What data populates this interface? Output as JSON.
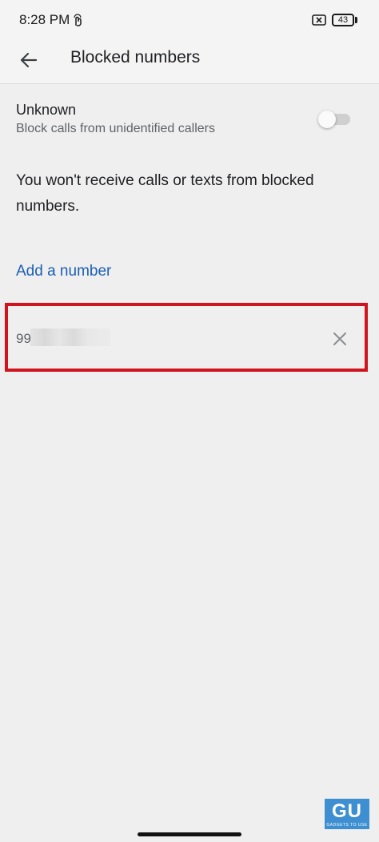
{
  "status_bar": {
    "time": "8:28 PM",
    "battery_level": "43",
    "icons": [
      "gesture-icon",
      "no-sim-icon",
      "battery-icon"
    ]
  },
  "app_bar": {
    "title": "Blocked numbers",
    "back_icon": "arrow-back-icon"
  },
  "unknown_setting": {
    "title": "Unknown",
    "subtitle": "Block calls from unidentified callers",
    "enabled": false
  },
  "notice": "You won't receive calls or texts from blocked numbers.",
  "add_number_label": "Add a number",
  "blocked_numbers": [
    {
      "number_visible": "99",
      "remove_icon": "close-icon"
    }
  ],
  "colors": {
    "highlight": "#d0141e",
    "link": "#1a5fb4",
    "background": "#efefef"
  },
  "watermark": {
    "letters": "GU",
    "text": "GADGETS TO USE"
  }
}
